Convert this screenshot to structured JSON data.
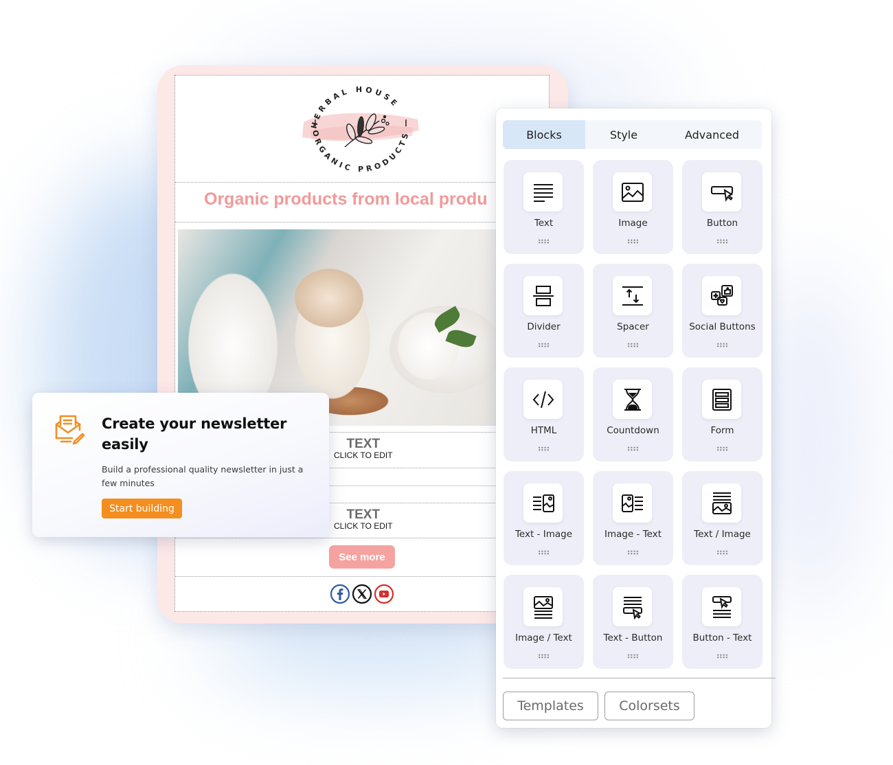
{
  "email": {
    "logo": {
      "top_text": "HERBAL HOUSE",
      "bottom_text": "ORGANIC PRODUCTS"
    },
    "heading": "Organic products from local produ",
    "text_blocks": [
      {
        "title": "TEXT",
        "subtitle": "CLICK TO EDIT"
      },
      {
        "title": "TEXT",
        "subtitle": "CLICK TO EDIT"
      }
    ],
    "button_label": "See more",
    "socials": [
      "facebook-icon",
      "x-icon",
      "youtube-icon"
    ]
  },
  "panel": {
    "tabs": [
      {
        "label": "Blocks",
        "active": true
      },
      {
        "label": "Style",
        "active": false
      },
      {
        "label": "Advanced",
        "active": false
      }
    ],
    "blocks": [
      {
        "label": "Text",
        "icon": "text-icon"
      },
      {
        "label": "Image",
        "icon": "image-icon"
      },
      {
        "label": "Button",
        "icon": "button-icon"
      },
      {
        "label": "Divider",
        "icon": "divider-icon"
      },
      {
        "label": "Spacer",
        "icon": "spacer-icon"
      },
      {
        "label": "Social Buttons",
        "icon": "social-buttons-icon"
      },
      {
        "label": "HTML",
        "icon": "code-icon"
      },
      {
        "label": "Countdown",
        "icon": "hourglass-icon"
      },
      {
        "label": "Form",
        "icon": "form-icon"
      },
      {
        "label": "Text - Image",
        "icon": "text-image-icon"
      },
      {
        "label": "Image - Text",
        "icon": "image-text-icon"
      },
      {
        "label": "Text / Image",
        "icon": "text-over-image-icon"
      },
      {
        "label": "Image / Text",
        "icon": "image-over-text-icon"
      },
      {
        "label": "Text - Button",
        "icon": "text-button-icon"
      },
      {
        "label": "Button - Text",
        "icon": "button-text-icon"
      }
    ],
    "footer_buttons": {
      "templates": "Templates",
      "colorsets": "Colorsets"
    }
  },
  "promo": {
    "title": "Create your newsletter easily",
    "description": "Build a professional quality newsletter in just a few minutes",
    "cta": "Start building",
    "accent_color": "#f38e1f"
  },
  "colors": {
    "heading_pink": "#f19a9a",
    "button_pink": "#f4a3a1",
    "frame_pink": "#fde8e8",
    "active_tab": "#d8e7f8",
    "block_bg": "#eeeef8"
  }
}
